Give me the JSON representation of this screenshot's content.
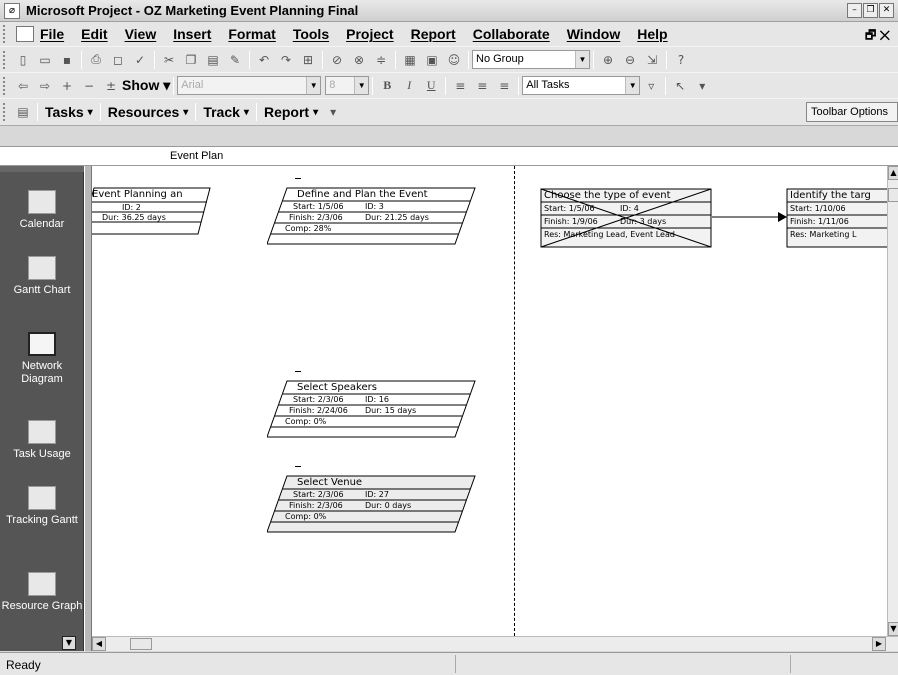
{
  "window": {
    "title": "Microsoft Project - OZ Marketing Event Planning Final"
  },
  "menu": [
    "File",
    "Edit",
    "View",
    "Insert",
    "Format",
    "Tools",
    "Project",
    "Report",
    "Collaborate",
    "Window",
    "Help"
  ],
  "toolbar": {
    "group_value": "No Group",
    "font_value": "Arial",
    "size_value": "8",
    "filter_value": "All Tasks",
    "show_label": "Show",
    "options_label": "Toolbar Options"
  },
  "guide": {
    "tasks": "Tasks",
    "resources": "Resources",
    "track": "Track",
    "report": "Report"
  },
  "entry": {
    "value": "Event Plan"
  },
  "views": [
    "Calendar",
    "Gantt Chart",
    "Network Diagram",
    "Task Usage",
    "Tracking Gantt",
    "Resource Graph"
  ],
  "nodes": [
    {
      "title": "Event Planning an",
      "start": "",
      "id": "ID:  2",
      "finish": "",
      "dur": "Dur: 36.25 days",
      "comp": ""
    },
    {
      "title": "Define and Plan the Event",
      "start": "Start:  1/5/06",
      "id": "ID:  3",
      "finish": "Finish: 2/3/06",
      "dur": "Dur: 21.25 days",
      "comp": "Comp: 28%"
    },
    {
      "title": "Choose the type of event",
      "start": "Start:  1/5/06",
      "id": "ID:  4",
      "finish": "Finish: 1/9/06",
      "dur": "Dur: 3 days",
      "res": "Res: Marketing Lead, Event Lead"
    },
    {
      "title": "Identify the targ",
      "start": "Start:  1/10/06",
      "finish": "Finish: 1/11/06",
      "res": "Res: Marketing L"
    },
    {
      "title": "Select Speakers",
      "start": "Start:  2/3/06",
      "id": "ID:  16",
      "finish": "Finish: 2/24/06",
      "dur": "Dur: 15 days",
      "comp": "Comp: 0%"
    },
    {
      "title": "Select Venue",
      "start": "Start:  2/3/06",
      "id": "ID:  27",
      "finish": "Finish: 2/3/06",
      "dur": "Dur: 0 days",
      "comp": "Comp: 0%"
    }
  ],
  "status": {
    "text": "Ready"
  }
}
